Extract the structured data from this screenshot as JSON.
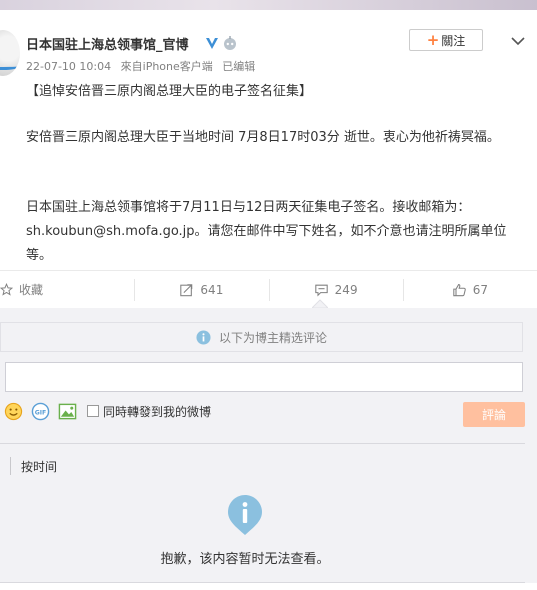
{
  "post": {
    "username": "日本国驻上海总领事馆_官博",
    "timestamp": "22-07-10 10:04",
    "source": "來自iPhone客户端",
    "edited": "已编辑",
    "follow_label": "關注",
    "paragraphs": [
      "【追悼安倍晋三原内阁总理大臣的电子签名征集】",
      "安倍晋三原内阁总理大臣于当地时间 7月8日17时03分 逝世。衷心为他祈祷冥福。",
      "日本国驻上海总领事馆将于7月11日与12日两天征集电子签名。接收邮箱为：sh.koubun@sh.mofa.go.jp。请您在邮件中写下姓名，如不介意也请注明所属单位等。"
    ]
  },
  "actions": {
    "favorite_label": "收藏",
    "repost_count": "641",
    "comment_count": "249",
    "like_count": "67"
  },
  "comments": {
    "notice": "以下为博主精选评论",
    "input_value": "",
    "also_repost_label": "同時轉發到我的微博",
    "submit_label": "評論",
    "sort_label": "按时间",
    "empty_message": "抱歉，该内容暂时无法查看。"
  },
  "colors": {
    "accent_orange": "#ff8140",
    "submit_disabled": "#ffc09f",
    "verified_blue": "#3d8fd6",
    "info_blue": "#8bc0df"
  }
}
